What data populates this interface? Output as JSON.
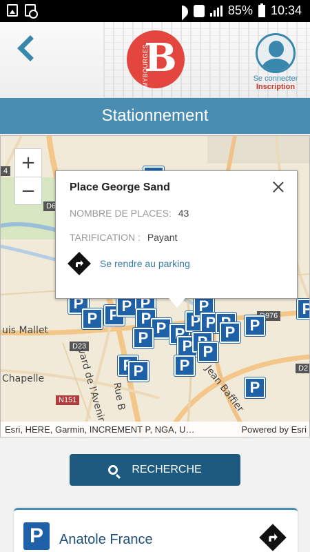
{
  "status_bar": {
    "battery": "85%",
    "time": "10:34"
  },
  "header": {
    "logo_small": "MYBOURGES",
    "logo_letter": "B",
    "login_label": "Se connecter",
    "signup_label": "Inscription"
  },
  "page_title": "Stationnement",
  "map": {
    "zoom_in": "+",
    "zoom_out": "−",
    "pin_glyph": "P",
    "labels": {
      "d6": "D6",
      "d23": "D23",
      "n151": "N151",
      "d976": "D976",
      "d2": "D2",
      "d4": "4",
      "louis_mallet": "uis Mallet",
      "chapelle": "Chapelle",
      "avenir": "vard de l'Avenir",
      "rue": "Rue B",
      "jean": "Jean Baffier"
    },
    "attribution": "Esri, HERE, Garmin, INCREMENT P, NGA, U…",
    "powered_by": "Powered by Esri"
  },
  "popup": {
    "title": "Place George Sand",
    "places_label": "NOMBRE DE PLACES:",
    "places_value": "43",
    "tarif_label": "TARIFICATION :",
    "tarif_value": "Payant",
    "directions_label": "Se rendre au parking"
  },
  "search": {
    "label": "RECHERCHE"
  },
  "results": [
    {
      "pin_glyph": "P",
      "name": "Anatole France"
    }
  ],
  "colors": {
    "brand_red": "#e3463f",
    "header_blue": "#4a8db3",
    "button_navy": "#1e5a80",
    "pin_blue": "#1f61a8"
  }
}
